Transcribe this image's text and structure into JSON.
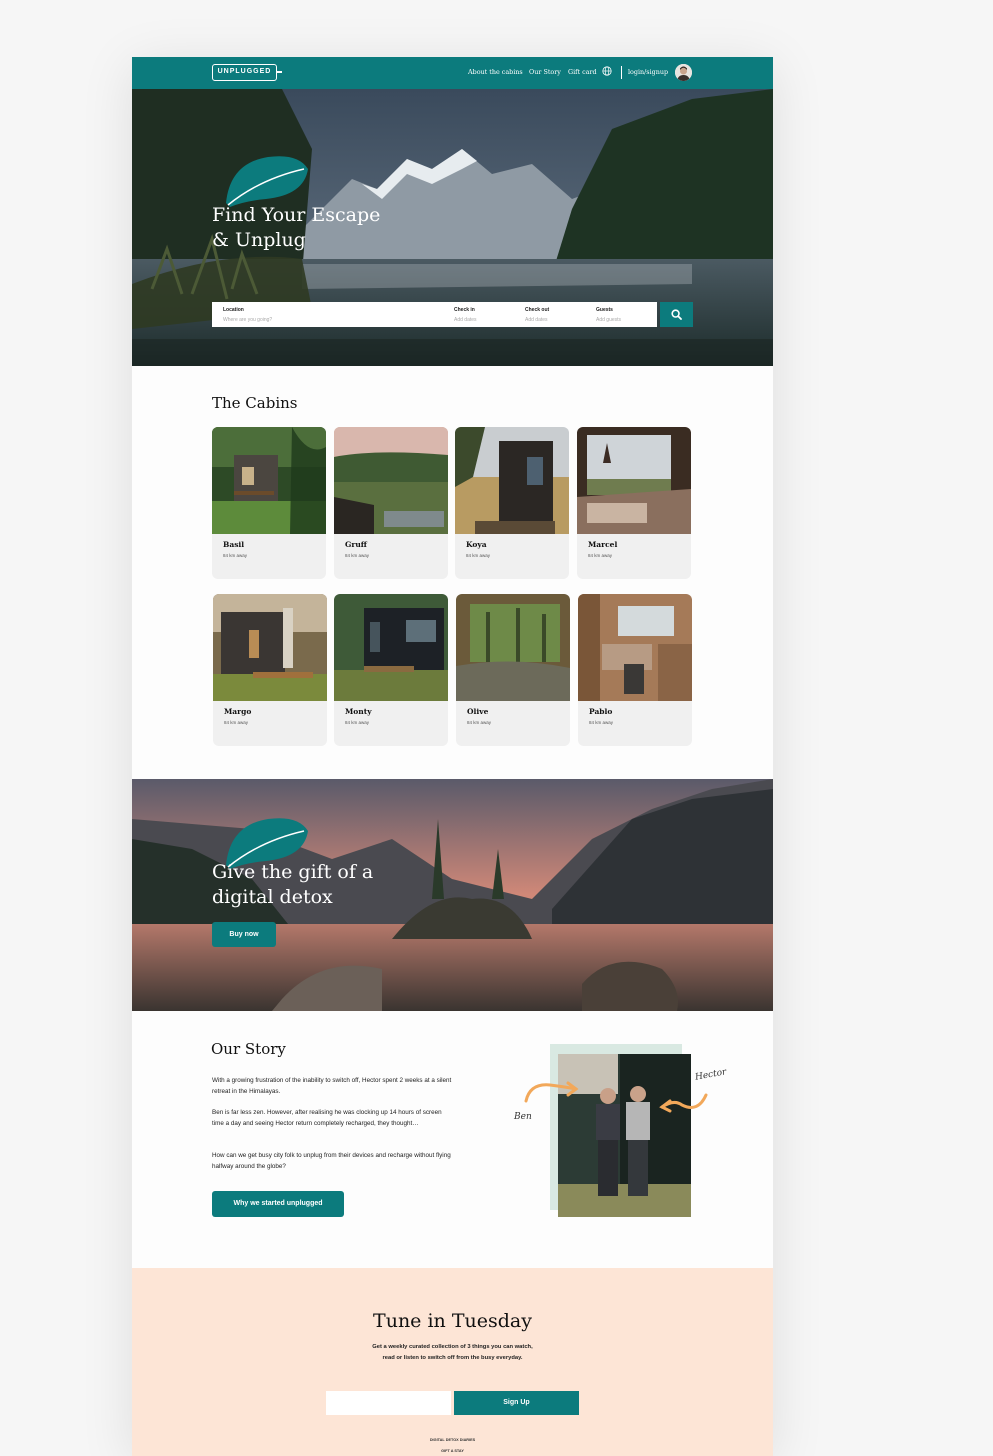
{
  "nav": {
    "logo": "UNPLUGGED",
    "links": [
      "About the cabins",
      "Our Story",
      "Gift card"
    ],
    "login": "login/signup"
  },
  "hero": {
    "title_line1": "Find Your Escape",
    "title_line2": "& Unplug",
    "search": {
      "location_label": "Location",
      "location_placeholder": "Where are you going?",
      "checkin_label": "Check in",
      "checkin_placeholder": "Add dates",
      "checkout_label": "Check out",
      "checkout_placeholder": "Add dates",
      "guests_label": "Guests",
      "guests_placeholder": "Add guests"
    }
  },
  "cabins": {
    "title": "The Cabins",
    "items": [
      {
        "name": "Basil",
        "distance": "84 km away"
      },
      {
        "name": "Gruff",
        "distance": "84 km away"
      },
      {
        "name": "Koya",
        "distance": "84 km away"
      },
      {
        "name": "Marcel",
        "distance": "84 km away"
      },
      {
        "name": "Margo",
        "distance": "84 km away"
      },
      {
        "name": "Monty",
        "distance": "84 km away"
      },
      {
        "name": "Olive",
        "distance": "84 km away"
      },
      {
        "name": "Pablo",
        "distance": "84 km away"
      }
    ]
  },
  "gift": {
    "title_line1": "Give the gift of a",
    "title_line2": "digital detox",
    "button": "Buy now"
  },
  "story": {
    "title": "Our Story",
    "p1": "With a growing frustration of the inability to switch off, Hector spent 2 weeks at a silent retreat in the Himalayas.",
    "p2": "Ben is far less zen. However, after realising he was clocking up 14 hours of screen time a day and seeing Hector return completely recharged, they thought…",
    "p3": "How can we get busy city folk to unplug from their devices and recharge without flying halfway around the globe?",
    "button": "Why we started unplugged",
    "label_ben": "Ben",
    "label_hector": "Hector"
  },
  "newsletter": {
    "title": "Tune in Tuesday",
    "description": "Get a weekly curated collection of 3 things you can watch, read or listen to switch off from the busy everyday.",
    "button": "Sign Up",
    "footer_link1": "DIGITAL DETOX DIARIES",
    "footer_link2": "GIFT A STAY"
  },
  "colors": {
    "brand_teal": "#0c7b7d",
    "peach_background": "#fde5d6",
    "card_background": "#f0f0f0"
  },
  "icons": [
    "globe-icon",
    "search-icon",
    "leaf-icon",
    "arrow-icon"
  ]
}
